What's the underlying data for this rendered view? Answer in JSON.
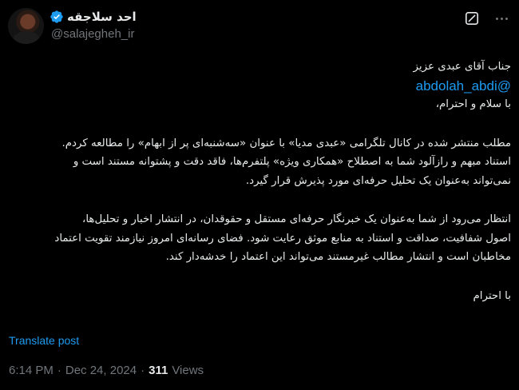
{
  "author": {
    "name": "احد سلاجقه",
    "handle": "@salajegheh_ir"
  },
  "tweet": {
    "lines_block1": [
      "جناب آقای عبدی عزیز",
      "@abdolah_abdi",
      "با سلام و احترام،"
    ],
    "lines_block2": [
      "مطلب منتشر شده در کانال تلگرامی «عبدی مدیا» با عنوان «سه‌شنبه‌ای پر از ابهام» را مطالعه کردم.",
      "استناد مبهم و رازآلود شما به اصطلاح «همکاری ویژه» پلتفرم‌ها، فاقد دقت و پشتوانه مستند است و",
      "نمی‌تواند به‌عنوان یک تحلیل حرفه‌ای مورد پذیرش قرار گیرد."
    ],
    "lines_block3": [
      "انتظار می‌رود از شما به‌عنوان یک خبرنگار حرفه‌ای مستقل و حقوقدان، در انتشار اخبار و تحلیل‌ها،",
      "اصول شفافیت، صداقت و استناد به منابع موثق رعایت شود. فضای رسانه‌ای امروز نیازمند تقویت اعتماد",
      "مخاطبان است و انتشار مطالب غیرمستند می‌تواند این اعتماد را خدشه‌دار کند."
    ],
    "closing": "با احترام"
  },
  "translate_label": "Translate post",
  "meta": {
    "time": "6:14 PM",
    "sep1": "·",
    "date": "Dec 24, 2024",
    "sep2": "·",
    "views_count": "311",
    "views_label": "Views"
  },
  "colors": {
    "background": "#000000",
    "text": "#e7e9ea",
    "muted": "#71767b",
    "link": "#1d9bf0"
  },
  "icons": {
    "verified": "verified-badge-icon",
    "grok": "grok-icon",
    "more": "more-options-icon"
  }
}
